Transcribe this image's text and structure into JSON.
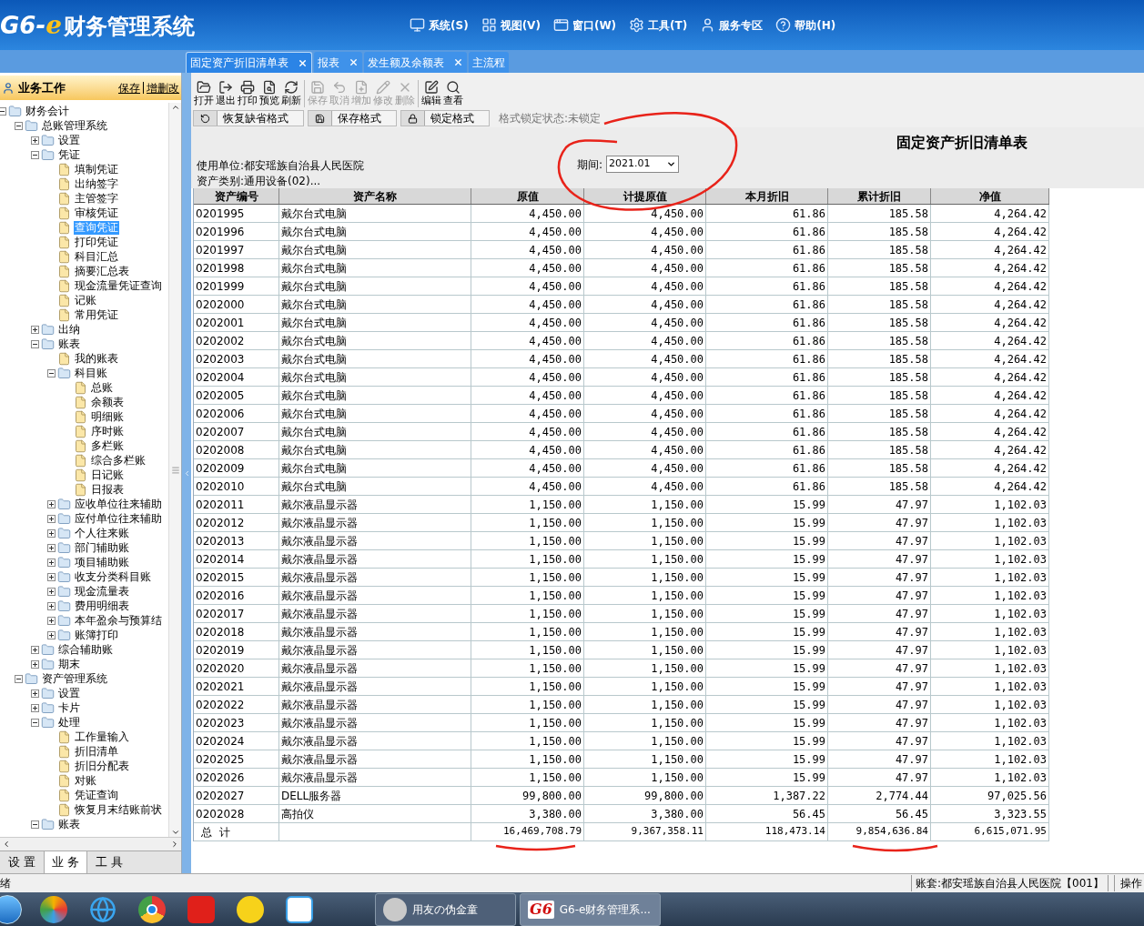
{
  "app": {
    "logo_prefix": "G6-",
    "logo_e": "e",
    "logo_name": "财务管理系统"
  },
  "menu": [
    "系统(S)",
    "视图(V)",
    "窗口(W)",
    "工具(T)",
    "服务专区",
    "帮助(H)"
  ],
  "tabs": [
    {
      "label": "固定资产折旧清单表",
      "selected": true,
      "closable": true
    },
    {
      "label": "报表",
      "selected": false,
      "closable": true
    },
    {
      "label": "发生额及余额表",
      "selected": false,
      "closable": true
    },
    {
      "label": "主流程",
      "selected": false,
      "closable": false
    }
  ],
  "sidebar": {
    "title": "业务工作",
    "links": [
      "保存",
      "增删改"
    ],
    "tree": [
      {
        "kind": "folder",
        "label": "财务会计",
        "expanded": true,
        "selected": false,
        "children": [
          {
            "kind": "folder",
            "label": "总账管理系统",
            "expanded": true,
            "selected": false,
            "children": [
              {
                "kind": "folder",
                "label": "设置",
                "expanded": false,
                "selected": false
              },
              {
                "kind": "folder",
                "label": "凭证",
                "expanded": true,
                "selected": false,
                "children": [
                  {
                    "kind": "leaf",
                    "label": "填制凭证",
                    "selected": false
                  },
                  {
                    "kind": "leaf",
                    "label": "出纳签字",
                    "selected": false
                  },
                  {
                    "kind": "leaf",
                    "label": "主管签字",
                    "selected": false
                  },
                  {
                    "kind": "leaf",
                    "label": "审核凭证",
                    "selected": false
                  },
                  {
                    "kind": "leaf",
                    "label": "查询凭证",
                    "selected": true
                  },
                  {
                    "kind": "leaf",
                    "label": "打印凭证",
                    "selected": false
                  },
                  {
                    "kind": "leaf",
                    "label": "科目汇总",
                    "selected": false
                  },
                  {
                    "kind": "leaf",
                    "label": "摘要汇总表",
                    "selected": false
                  },
                  {
                    "kind": "leaf",
                    "label": "现金流量凭证查询",
                    "selected": false
                  },
                  {
                    "kind": "leaf",
                    "label": "记账",
                    "selected": false
                  },
                  {
                    "kind": "leaf",
                    "label": "常用凭证",
                    "selected": false
                  }
                ]
              },
              {
                "kind": "folder",
                "label": "出纳",
                "expanded": false,
                "selected": false
              },
              {
                "kind": "folder",
                "label": "账表",
                "expanded": true,
                "selected": false,
                "children": [
                  {
                    "kind": "leaf",
                    "label": "我的账表",
                    "selected": false
                  },
                  {
                    "kind": "folder",
                    "label": "科目账",
                    "expanded": true,
                    "selected": false,
                    "children": [
                      {
                        "kind": "leaf",
                        "label": "总账",
                        "selected": false
                      },
                      {
                        "kind": "leaf",
                        "label": "余额表",
                        "selected": false
                      },
                      {
                        "kind": "leaf",
                        "label": "明细账",
                        "selected": false
                      },
                      {
                        "kind": "leaf",
                        "label": "序时账",
                        "selected": false
                      },
                      {
                        "kind": "leaf",
                        "label": "多栏账",
                        "selected": false
                      },
                      {
                        "kind": "leaf",
                        "label": "综合多栏账",
                        "selected": false
                      },
                      {
                        "kind": "leaf",
                        "label": "日记账",
                        "selected": false
                      },
                      {
                        "kind": "leaf",
                        "label": "日报表",
                        "selected": false
                      }
                    ]
                  },
                  {
                    "kind": "folder",
                    "label": "应收单位往来辅助",
                    "expanded": false,
                    "selected": false
                  },
                  {
                    "kind": "folder",
                    "label": "应付单位往来辅助",
                    "expanded": false,
                    "selected": false
                  },
                  {
                    "kind": "folder",
                    "label": "个人往来账",
                    "expanded": false,
                    "selected": false
                  },
                  {
                    "kind": "folder",
                    "label": "部门辅助账",
                    "expanded": false,
                    "selected": false
                  },
                  {
                    "kind": "folder",
                    "label": "项目辅助账",
                    "expanded": false,
                    "selected": false
                  },
                  {
                    "kind": "folder",
                    "label": "收支分类科目账",
                    "expanded": false,
                    "selected": false
                  },
                  {
                    "kind": "folder",
                    "label": "现金流量表",
                    "expanded": false,
                    "selected": false
                  },
                  {
                    "kind": "folder",
                    "label": "费用明细表",
                    "expanded": false,
                    "selected": false
                  },
                  {
                    "kind": "folder",
                    "label": "本年盈余与预算结",
                    "expanded": false,
                    "selected": false
                  },
                  {
                    "kind": "folder",
                    "label": "账簿打印",
                    "expanded": false,
                    "selected": false
                  }
                ]
              },
              {
                "kind": "folder",
                "label": "综合辅助账",
                "expanded": false,
                "selected": false
              },
              {
                "kind": "folder",
                "label": "期末",
                "expanded": false,
                "selected": false
              }
            ]
          },
          {
            "kind": "folder",
            "label": "资产管理系统",
            "expanded": true,
            "selected": false,
            "children": [
              {
                "kind": "folder",
                "label": "设置",
                "expanded": false,
                "selected": false
              },
              {
                "kind": "folder",
                "label": "卡片",
                "expanded": false,
                "selected": false
              },
              {
                "kind": "folder",
                "label": "处理",
                "expanded": true,
                "selected": false,
                "children": [
                  {
                    "kind": "leaf",
                    "label": "工作量输入",
                    "selected": false
                  },
                  {
                    "kind": "leaf",
                    "label": "折旧清单",
                    "selected": false
                  },
                  {
                    "kind": "leaf",
                    "label": "折旧分配表",
                    "selected": false
                  },
                  {
                    "kind": "leaf",
                    "label": "对账",
                    "selected": false
                  },
                  {
                    "kind": "leaf",
                    "label": "凭证查询",
                    "selected": false
                  },
                  {
                    "kind": "leaf",
                    "label": "恢复月末结账前状",
                    "selected": false
                  }
                ]
              },
              {
                "kind": "folder",
                "label": "账表",
                "expanded": true,
                "selected": false
              }
            ]
          }
        ]
      }
    ],
    "bottom_tabs": [
      {
        "label": "设 置",
        "selected": false
      },
      {
        "label": "业 务",
        "selected": true
      },
      {
        "label": "工 具",
        "selected": false
      }
    ]
  },
  "toolbar": [
    {
      "label": "打开",
      "disabled": false
    },
    {
      "label": "退出",
      "disabled": false
    },
    {
      "label": "打印",
      "disabled": false
    },
    {
      "label": "预览",
      "disabled": false
    },
    {
      "label": "刷新",
      "disabled": false
    },
    {
      "label": "保存",
      "disabled": true
    },
    {
      "label": "取消",
      "disabled": true
    },
    {
      "label": "增加",
      "disabled": true
    },
    {
      "label": "修改",
      "disabled": true
    },
    {
      "label": "删除",
      "disabled": true
    },
    {
      "label": "编辑",
      "disabled": false
    },
    {
      "label": "查看",
      "disabled": false
    }
  ],
  "format_bar": {
    "buttons": [
      "恢复缺省格式",
      "保存格式",
      "锁定格式"
    ],
    "lock_status": "格式锁定状态:未锁定"
  },
  "report": {
    "title": "固定资产折旧清单表",
    "unit": "使用单位:都安瑶族自治县人民医院",
    "period_label": "期间:",
    "period": "2021.01",
    "category": "资产类别:通用设备(02)..."
  },
  "table": {
    "columns": [
      "资产编号",
      "资产名称",
      "原值",
      "计提原值",
      "本月折旧",
      "累计折旧",
      "净值"
    ],
    "rows": [
      [
        "0201995",
        "戴尔台式电脑",
        "4,450.00",
        "4,450.00",
        "61.86",
        "185.58",
        "4,264.42"
      ],
      [
        "0201996",
        "戴尔台式电脑",
        "4,450.00",
        "4,450.00",
        "61.86",
        "185.58",
        "4,264.42"
      ],
      [
        "0201997",
        "戴尔台式电脑",
        "4,450.00",
        "4,450.00",
        "61.86",
        "185.58",
        "4,264.42"
      ],
      [
        "0201998",
        "戴尔台式电脑",
        "4,450.00",
        "4,450.00",
        "61.86",
        "185.58",
        "4,264.42"
      ],
      [
        "0201999",
        "戴尔台式电脑",
        "4,450.00",
        "4,450.00",
        "61.86",
        "185.58",
        "4,264.42"
      ],
      [
        "0202000",
        "戴尔台式电脑",
        "4,450.00",
        "4,450.00",
        "61.86",
        "185.58",
        "4,264.42"
      ],
      [
        "0202001",
        "戴尔台式电脑",
        "4,450.00",
        "4,450.00",
        "61.86",
        "185.58",
        "4,264.42"
      ],
      [
        "0202002",
        "戴尔台式电脑",
        "4,450.00",
        "4,450.00",
        "61.86",
        "185.58",
        "4,264.42"
      ],
      [
        "0202003",
        "戴尔台式电脑",
        "4,450.00",
        "4,450.00",
        "61.86",
        "185.58",
        "4,264.42"
      ],
      [
        "0202004",
        "戴尔台式电脑",
        "4,450.00",
        "4,450.00",
        "61.86",
        "185.58",
        "4,264.42"
      ],
      [
        "0202005",
        "戴尔台式电脑",
        "4,450.00",
        "4,450.00",
        "61.86",
        "185.58",
        "4,264.42"
      ],
      [
        "0202006",
        "戴尔台式电脑",
        "4,450.00",
        "4,450.00",
        "61.86",
        "185.58",
        "4,264.42"
      ],
      [
        "0202007",
        "戴尔台式电脑",
        "4,450.00",
        "4,450.00",
        "61.86",
        "185.58",
        "4,264.42"
      ],
      [
        "0202008",
        "戴尔台式电脑",
        "4,450.00",
        "4,450.00",
        "61.86",
        "185.58",
        "4,264.42"
      ],
      [
        "0202009",
        "戴尔台式电脑",
        "4,450.00",
        "4,450.00",
        "61.86",
        "185.58",
        "4,264.42"
      ],
      [
        "0202010",
        "戴尔台式电脑",
        "4,450.00",
        "4,450.00",
        "61.86",
        "185.58",
        "4,264.42"
      ],
      [
        "0202011",
        "戴尔液晶显示器",
        "1,150.00",
        "1,150.00",
        "15.99",
        "47.97",
        "1,102.03"
      ],
      [
        "0202012",
        "戴尔液晶显示器",
        "1,150.00",
        "1,150.00",
        "15.99",
        "47.97",
        "1,102.03"
      ],
      [
        "0202013",
        "戴尔液晶显示器",
        "1,150.00",
        "1,150.00",
        "15.99",
        "47.97",
        "1,102.03"
      ],
      [
        "0202014",
        "戴尔液晶显示器",
        "1,150.00",
        "1,150.00",
        "15.99",
        "47.97",
        "1,102.03"
      ],
      [
        "0202015",
        "戴尔液晶显示器",
        "1,150.00",
        "1,150.00",
        "15.99",
        "47.97",
        "1,102.03"
      ],
      [
        "0202016",
        "戴尔液晶显示器",
        "1,150.00",
        "1,150.00",
        "15.99",
        "47.97",
        "1,102.03"
      ],
      [
        "0202017",
        "戴尔液晶显示器",
        "1,150.00",
        "1,150.00",
        "15.99",
        "47.97",
        "1,102.03"
      ],
      [
        "0202018",
        "戴尔液晶显示器",
        "1,150.00",
        "1,150.00",
        "15.99",
        "47.97",
        "1,102.03"
      ],
      [
        "0202019",
        "戴尔液晶显示器",
        "1,150.00",
        "1,150.00",
        "15.99",
        "47.97",
        "1,102.03"
      ],
      [
        "0202020",
        "戴尔液晶显示器",
        "1,150.00",
        "1,150.00",
        "15.99",
        "47.97",
        "1,102.03"
      ],
      [
        "0202021",
        "戴尔液晶显示器",
        "1,150.00",
        "1,150.00",
        "15.99",
        "47.97",
        "1,102.03"
      ],
      [
        "0202022",
        "戴尔液晶显示器",
        "1,150.00",
        "1,150.00",
        "15.99",
        "47.97",
        "1,102.03"
      ],
      [
        "0202023",
        "戴尔液晶显示器",
        "1,150.00",
        "1,150.00",
        "15.99",
        "47.97",
        "1,102.03"
      ],
      [
        "0202024",
        "戴尔液晶显示器",
        "1,150.00",
        "1,150.00",
        "15.99",
        "47.97",
        "1,102.03"
      ],
      [
        "0202025",
        "戴尔液晶显示器",
        "1,150.00",
        "1,150.00",
        "15.99",
        "47.97",
        "1,102.03"
      ],
      [
        "0202026",
        "戴尔液晶显示器",
        "1,150.00",
        "1,150.00",
        "15.99",
        "47.97",
        "1,102.03"
      ],
      [
        "0202027",
        "DELL服务器",
        "99,800.00",
        "99,800.00",
        "1,387.22",
        "2,774.44",
        "97,025.56"
      ],
      [
        "0202028",
        "高拍仪",
        "3,380.00",
        "3,380.00",
        "56.45",
        "56.45",
        "3,323.55"
      ]
    ],
    "total": {
      "label": "总  计",
      "values": [
        "16,469,708.79",
        "9,367,358.11",
        "118,473.14",
        "9,854,636.84",
        "6,615,071.95"
      ]
    }
  },
  "status_bar": {
    "status": "绪",
    "account": "账套:都安瑶族自治县人民医院【001】",
    "operator": "操作"
  },
  "taskbar": {
    "windows": [
      {
        "label": "用友の伪金童",
        "selected": false
      },
      {
        "label": "G6-e财务管理系...",
        "logo": "G6",
        "selected": true
      }
    ]
  }
}
